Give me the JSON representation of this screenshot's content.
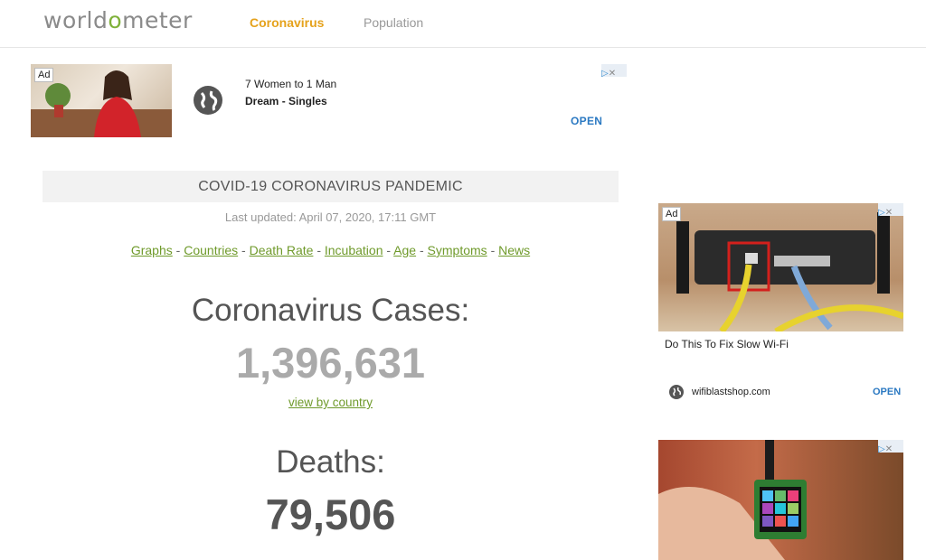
{
  "header": {
    "logo_left": "world",
    "logo_o": "o",
    "logo_right": "meter",
    "nav": [
      "Coronavirus",
      "Population"
    ]
  },
  "top_ad": {
    "badge": "Ad",
    "line1": "7 Women to 1 Man",
    "line2": "Dream - Singles",
    "cta": "OPEN",
    "icon": "globe-icon"
  },
  "main": {
    "title": "COVID-19 CORONAVIRUS PANDEMIC",
    "last_updated": "Last updated: April 07, 2020, 17:11 GMT",
    "links": [
      "Graphs",
      "Countries",
      "Death Rate",
      "Incubation",
      "Age",
      "Symptoms",
      "News"
    ],
    "separator": "-",
    "cases_label": "Coronavirus Cases:",
    "cases_value": "1,396,631",
    "view_by_country": "view by country",
    "deaths_label": "Deaths:",
    "deaths_value": "79,506"
  },
  "right_ad_1": {
    "badge": "Ad",
    "title": "Do This To Fix Slow Wi-Fi",
    "domain": "wifiblastshop.com",
    "cta": "OPEN"
  },
  "colors": {
    "accent": "#e5a21c",
    "link": "#6f9a2b",
    "ad_cta": "#2b79c2"
  }
}
